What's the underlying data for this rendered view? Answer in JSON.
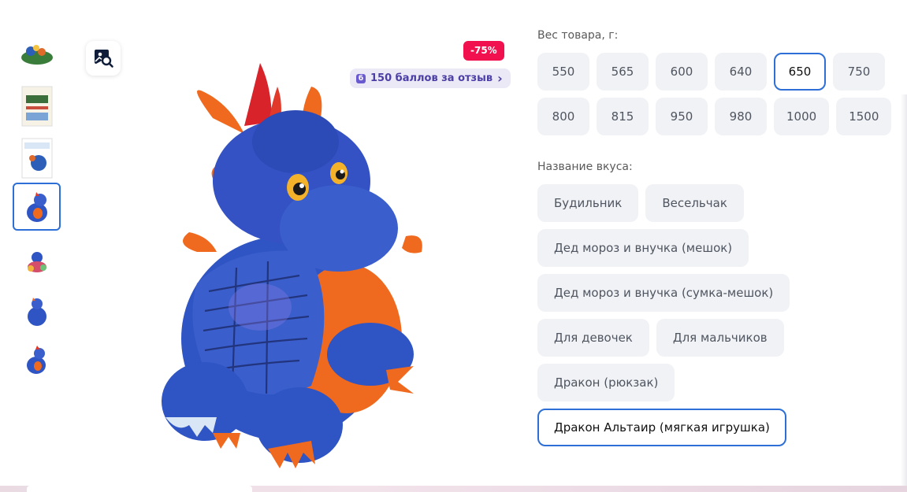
{
  "thumbnails": [
    {
      "name": "thumb-1",
      "active": false
    },
    {
      "name": "thumb-2",
      "active": false
    },
    {
      "name": "thumb-3",
      "active": false
    },
    {
      "name": "thumb-4",
      "active": true
    },
    {
      "name": "thumb-5",
      "active": false
    },
    {
      "name": "thumb-6",
      "active": false
    },
    {
      "name": "thumb-7",
      "active": false
    }
  ],
  "product_image": {
    "discount": "-75%",
    "points_icon": "б",
    "points_text": "150 баллов за отзыв",
    "points_chevron": "›"
  },
  "weight": {
    "label": "Вес товара, г:",
    "options": [
      "550",
      "565",
      "600",
      "640",
      "650",
      "750",
      "800",
      "815",
      "950",
      "980",
      "1000",
      "1500"
    ],
    "selected": "650"
  },
  "flavor": {
    "label": "Название вкуса:",
    "options": [
      "Будильник",
      "Весельчак",
      "Дед мороз и внучка (мешок)",
      "Дед мороз и внучка (сумка-мешок)",
      "Для девочек",
      "Для мальчиков",
      "Дракон (рюкзак)",
      "Дракон Альтаир (мягкая игрушка)"
    ],
    "selected": "Дракон Альтаир (мягкая игрушка)"
  },
  "colors": {
    "accent": "#2d6fd6",
    "discount": "#f0114e",
    "points_bg": "#ece9f7",
    "points_text": "#4b3fa6"
  }
}
